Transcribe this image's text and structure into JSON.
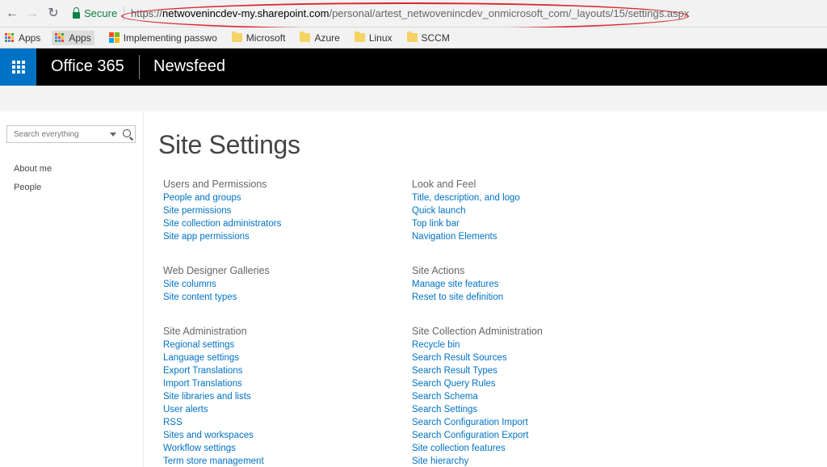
{
  "browser": {
    "secure_label": "Secure",
    "url_scheme": "https://",
    "url_host": "netwoveninc­dev-my.sharepoint.com",
    "url_path": "/personal/artest_netwovenincdev_onmicrosoft_com/_layouts/15/settings.aspx",
    "bookmarks": [
      "Apps",
      "Apps",
      "Implementing passwo",
      "Microsoft",
      "Azure",
      "Linux",
      "SCCM"
    ]
  },
  "suite": {
    "brand": "Office 365",
    "app_title": "Newsfeed"
  },
  "leftnav": {
    "search_placeholder": "Search everything",
    "items": [
      "About me",
      "People"
    ]
  },
  "main": {
    "title": "Site Settings",
    "sections": [
      {
        "heading": "Users and Permissions",
        "links": [
          "People and groups",
          "Site permissions",
          "Site collection administrators",
          "Site app permissions"
        ]
      },
      {
        "heading": "Web Designer Galleries",
        "links": [
          "Site columns",
          "Site content types"
        ]
      },
      {
        "heading": "Site Administration",
        "links": [
          "Regional settings",
          "Language settings",
          "Export Translations",
          "Import Translations",
          "Site libraries and lists",
          "User alerts",
          "RSS",
          "Sites and workspaces",
          "Workflow settings",
          "Term store management"
        ]
      },
      {
        "heading": "Look and Feel",
        "links": [
          "Title, description, and logo",
          "Quick launch",
          "Top link bar",
          "Navigation Elements"
        ]
      },
      {
        "heading": "Site Actions",
        "links": [
          "Manage site features",
          "Reset to site definition"
        ]
      },
      {
        "heading": "Site Collection Administration",
        "links": [
          "Recycle bin",
          "Search Result Sources",
          "Search Result Types",
          "Search Query Rules",
          "Search Schema",
          "Search Settings",
          "Search Configuration Import",
          "Search Configuration Export",
          "Site collection features",
          "Site hierarchy"
        ]
      }
    ]
  },
  "colors": {
    "accent": "#0072c6",
    "suitebar": "#000000",
    "annotation": "#d9262e"
  }
}
